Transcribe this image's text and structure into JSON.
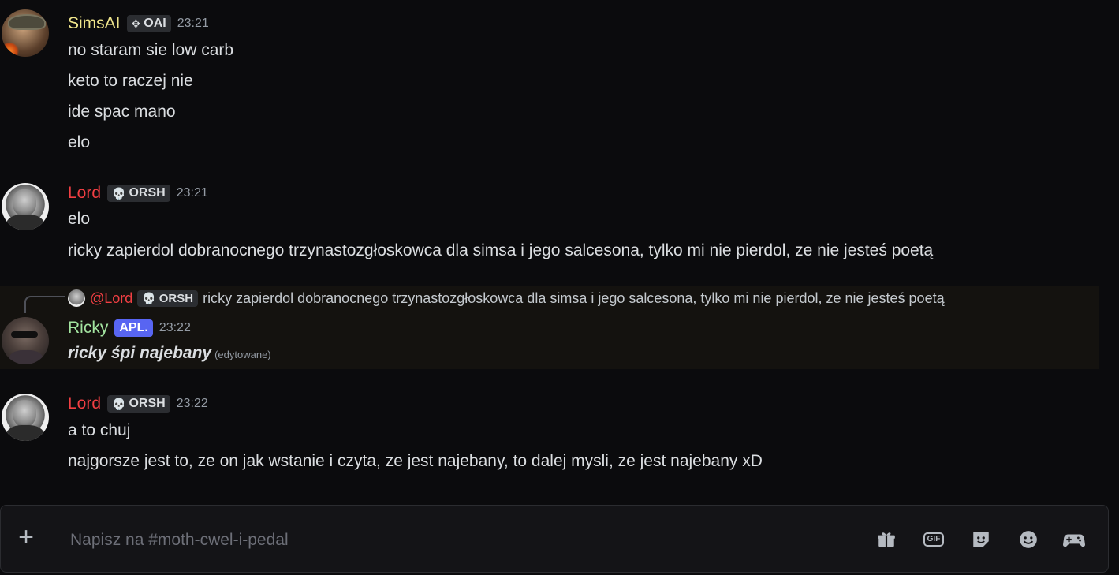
{
  "messages": [
    {
      "author": "SimsAI",
      "author_color": "#f0e68c",
      "badge": {
        "icon": "diamond-move-icon",
        "label": "OAI"
      },
      "time": "23:21",
      "lines": [
        "no staram sie low carb",
        "keto to raczej nie",
        "ide spac mano",
        "elo"
      ]
    },
    {
      "author": "Lord",
      "author_color": "#f23f43",
      "badge": {
        "icon": "skull-icon",
        "label": "ORSH"
      },
      "time": "23:21",
      "lines": [
        "elo",
        "ricky zapierdol dobranocnego trzynastozgłoskowca dla simsa i jego salcesona, tylko mi nie pierdol, ze nie jesteś poetą"
      ]
    },
    {
      "reply_to": {
        "mention": "@Lord",
        "badge": {
          "icon": "skull-icon",
          "label": "ORSH"
        },
        "text": "ricky zapierdol dobranocnego trzynastozgłoskowca dla simsa i jego salcesona, tylko mi nie pierdol, ze nie jesteś poetą"
      },
      "author": "Ricky",
      "author_color": "#a3e4a0",
      "badge": {
        "label": "APL."
      },
      "time": "23:22",
      "lines": [
        "ricky śpi najebany"
      ],
      "edited": "(edytowane)"
    },
    {
      "author": "Lord",
      "author_color": "#f23f43",
      "badge": {
        "icon": "skull-icon",
        "label": "ORSH"
      },
      "time": "23:22",
      "lines": [
        "a to chuj",
        "najgorsze jest to, ze on jak wstanie i czyta, ze jest najebany, to dalej mysli, ze jest najebany xD"
      ]
    }
  ],
  "composer": {
    "placeholder": "Napisz na #moth-cwel-i-pedal",
    "tools": [
      "gift-icon",
      "gif-icon",
      "sticker-icon",
      "emoji-icon",
      "gamepad-icon"
    ]
  },
  "colors": {
    "background": "#0b0b0d",
    "badge_blue": "#5865f2",
    "skull_red": "#f23f43"
  }
}
